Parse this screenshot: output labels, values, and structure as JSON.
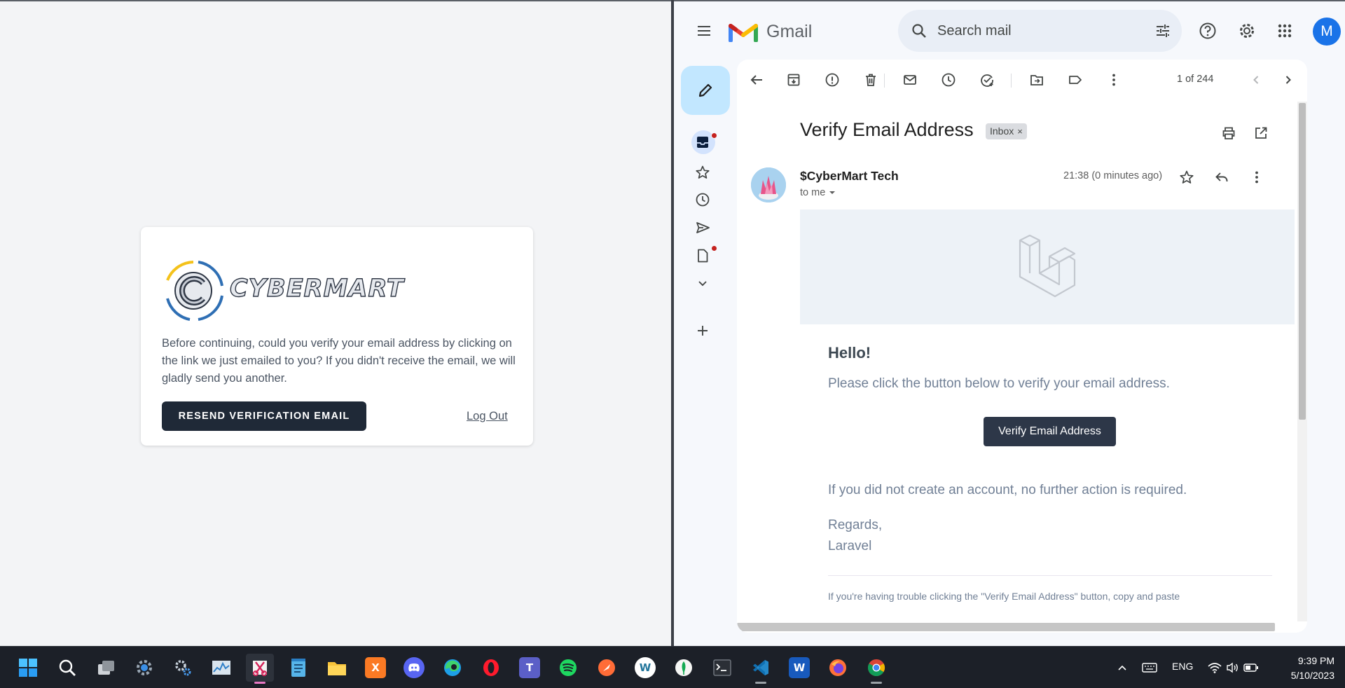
{
  "left_page": {
    "logo_text": "CYBERMART",
    "message": "Before continuing, could you verify your email address by clicking on the link we just emailed to you? If you didn't receive the email, we will gladly send you another.",
    "resend_label": "RESEND VERIFICATION EMAIL",
    "logout_label": "Log Out"
  },
  "gmail": {
    "app_name": "Gmail",
    "search_placeholder": "Search mail",
    "avatar_letter": "M",
    "pagination": "1 of 244",
    "subject": "Verify Email Address",
    "label_chip": "Inbox",
    "label_chip_close": "×",
    "sender": "$CyberMart Tech",
    "recipient": "to me",
    "time": "21:38 (0 minutes ago)",
    "body": {
      "greeting": "Hello!",
      "line1": "Please click the button below to verify your email address.",
      "button": "Verify Email Address",
      "line2": "If you did not create an account, no further action is required.",
      "regards": "Regards,",
      "signature": "Laravel",
      "footer": "If you're having trouble clicking the \"Verify Email Address\" button, copy and paste"
    },
    "colors": {
      "compose_bg": "#c2e7ff",
      "avatar_bg": "#1a73e8",
      "notify_dot": "#c5221f",
      "mail_button": "#2d3748"
    }
  },
  "taskbar": {
    "apps": [
      "start",
      "search",
      "task-view",
      "settings-gear",
      "control-panel",
      "resource-monitor",
      "snipping-tool",
      "notepad",
      "file-explorer",
      "xampp",
      "discord",
      "edge",
      "opera",
      "teams",
      "spotify",
      "postman",
      "wordpress",
      "mongodb-compass",
      "terminal",
      "vscode",
      "word",
      "firefox",
      "chrome"
    ],
    "lang": "ENG",
    "time": "9:39 PM",
    "date": "5/10/2023"
  }
}
